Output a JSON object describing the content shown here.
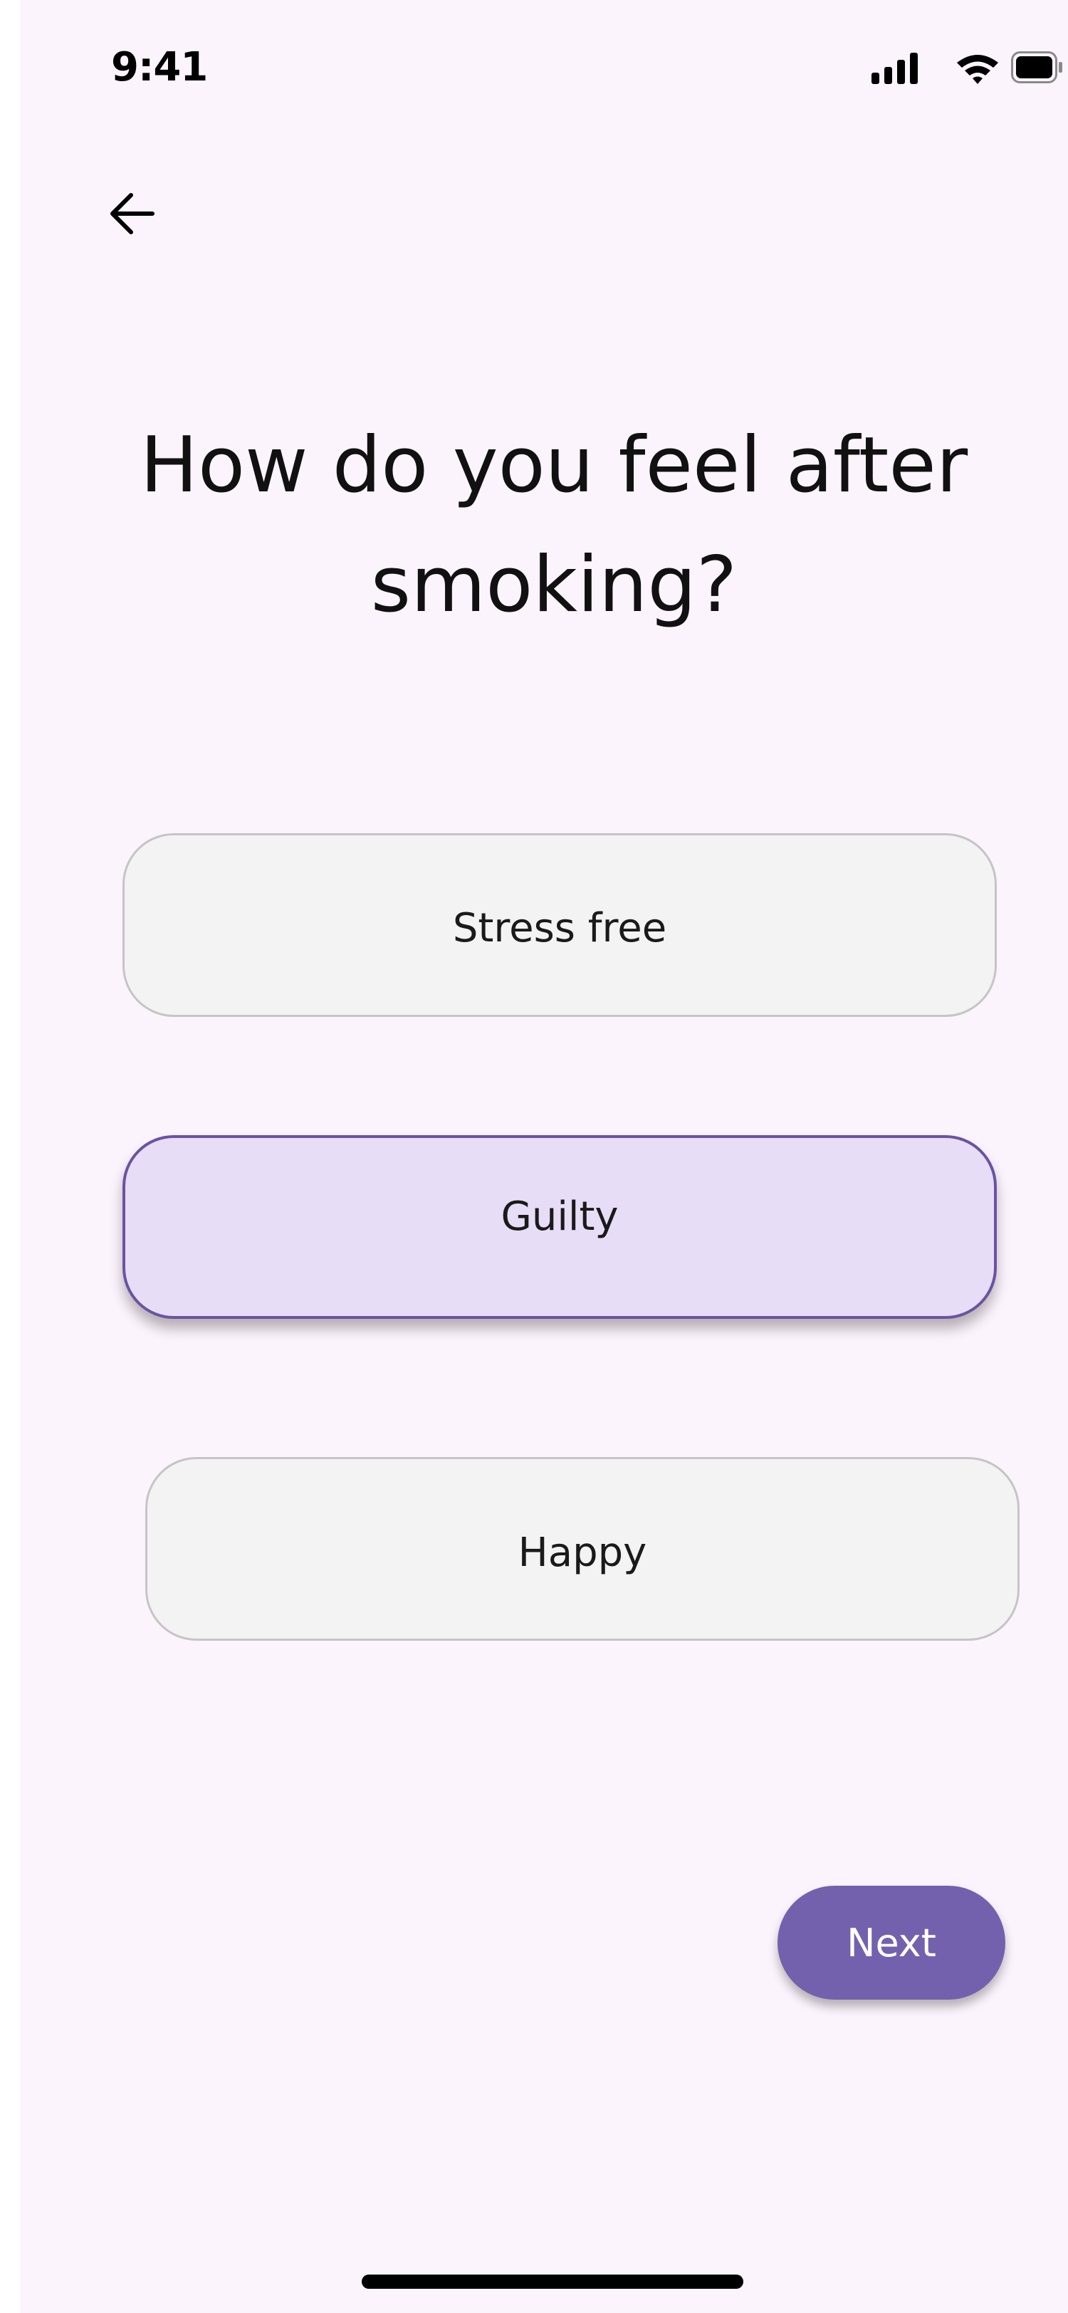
{
  "status_bar": {
    "time": "9:41",
    "icons": [
      "signal-icon",
      "wifi-icon",
      "battery-icon"
    ]
  },
  "nav": {
    "back_icon": "arrow-left-icon"
  },
  "question": {
    "line1": "How do you feel after",
    "line2": "smoking?"
  },
  "options": [
    {
      "label": "Stress free",
      "selected": false
    },
    {
      "label": "Guilty",
      "selected": true
    },
    {
      "label": "Happy",
      "selected": false
    }
  ],
  "next_button": {
    "label": "Next"
  },
  "colors": {
    "background": "#fcf4fc",
    "option_background": "#f3f3f3",
    "option_border": "#c6c4c6",
    "selected_background": "#e7ddf6",
    "selected_border": "#6a53a2",
    "accent": "#7361ad"
  }
}
